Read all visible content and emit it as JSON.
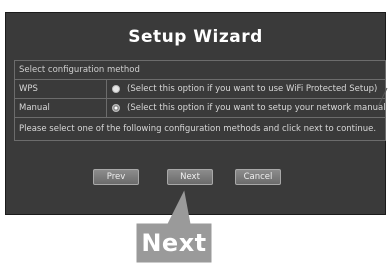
{
  "wizard": {
    "title": "Setup Wizard",
    "section_header": "Select configuration method",
    "options": [
      {
        "label": "WPS",
        "description": "(Select this option if you want to use WiFi Protected Setup)",
        "selected": false
      },
      {
        "label": "Manual",
        "description": "(Select this option if you want to setup your network manually)",
        "selected": true
      }
    ],
    "instruction": "Please select one of the following configuration methods and click next to continue.",
    "buttons": {
      "prev": "Prev",
      "next": "Next",
      "cancel": "Cancel"
    }
  },
  "callout": {
    "label": "Next"
  },
  "colors": {
    "panel_bg": "#3a3a3a",
    "callout_bg": "#9a9a9a"
  }
}
